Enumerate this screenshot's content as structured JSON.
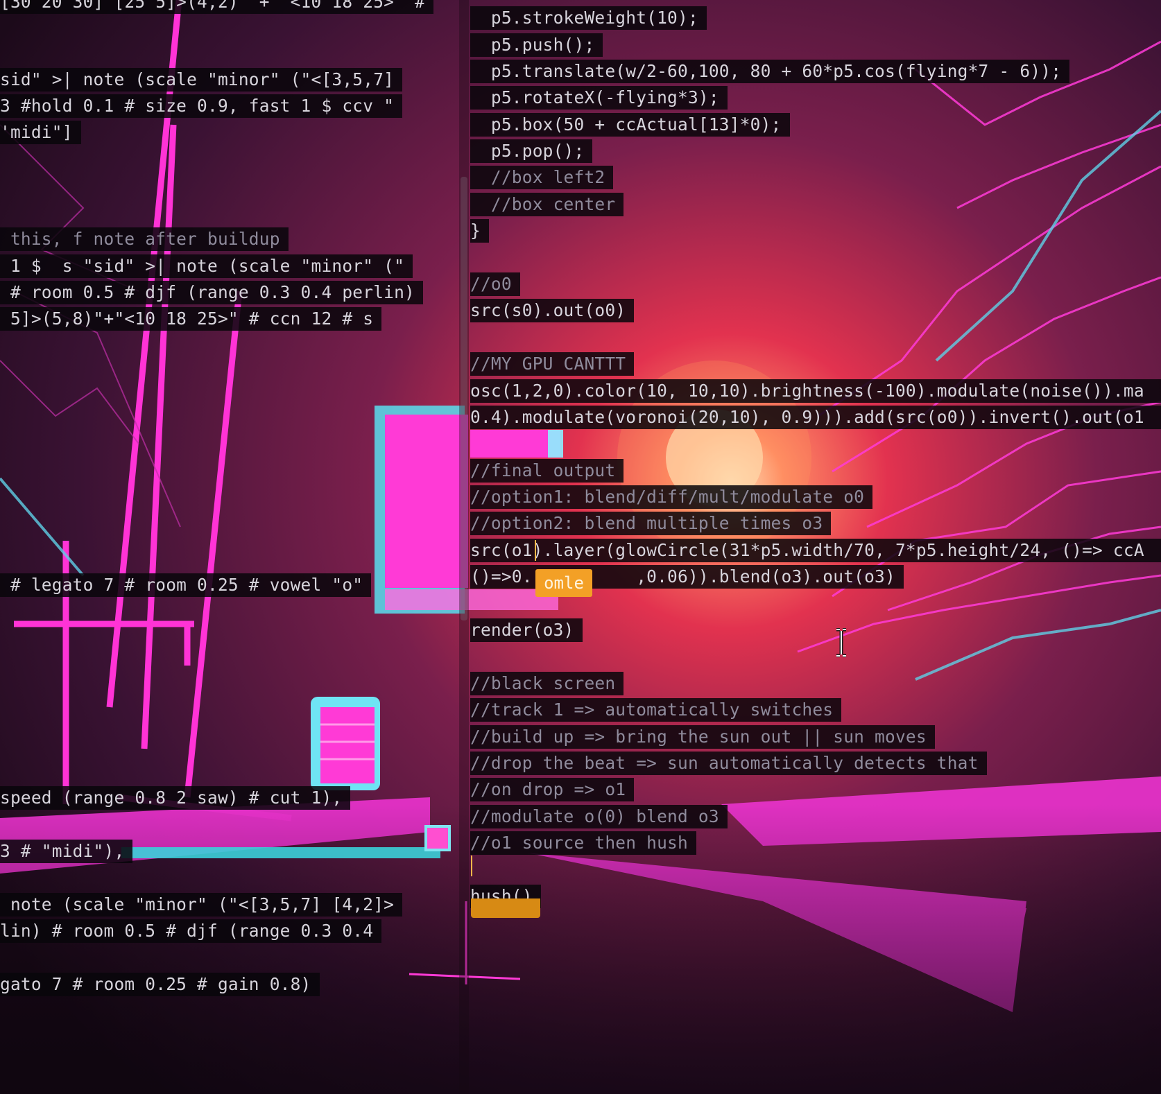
{
  "editor": {
    "left_pane": {
      "lines": [
        "[30 20 30] [25 5]>(4,2)\" + \"<10 18 25>\" #",
        "sid\" >| note (scale \"minor\" (\"<[3,5,7]",
        "3 #hold 0.1 # size 0.9, fast 1 $ ccv \"",
        "'midi\"]",
        " this, f note after buildup",
        " 1 $  s \"sid\" >| note (scale \"minor\" (\"",
        " # room 0.5 # djf (range 0.3 0.4 perlin)",
        " 5]>(5,8)\"+\"<10 18 25>\" # ccn 12 # s",
        " # legato 7 # room 0.25 # vowel \"o\"",
        "speed (range 0.8 2 saw) # cut 1),",
        "3 # \"midi\"),",
        " note (scale \"minor\" (\"<[3,5,7] [4,2]>",
        "lin) # room 0.5 # djf (range 0.3 0.4",
        "gato 7 # room 0.25 # gain 0.8)"
      ]
    },
    "right_pane": {
      "lines": [
        "  p5.strokeWeight(10);",
        "  p5.push();",
        "  p5.translate(w/2-60,100, 80 + 60*p5.cos(flying*7 - 6));",
        "  p5.rotateX(-flying*3);",
        "  p5.box(50 + ccActual[13]*0);",
        "  p5.pop();",
        "  //box left2",
        "  //box center",
        "}",
        "//o0",
        "src(s0).out(o0)",
        "//MY GPU CANTTT",
        "osc(1,2,0).color(10, 10,10).brightness(-100).modulate(noise()).ma",
        "0.4).modulate(voronoi(20,10), 0.9))).add(src(o0)).invert().out(o1",
        "//final output",
        "//option1: blend/diff/mult/modulate o0",
        "//option2: blend multiple times o3",
        "src(o1).layer(glowCircle(31*p5.width/70, 7*p5.height/24, ()=> ccA",
        "()=>0.          ,0.06)).blend(o3).out(o3)",
        "render(o3)",
        "//black screen",
        "//track 1 => automatically switches",
        "//build up => bring the sun out || sun moves",
        "//drop the beat => sun automatically detects that",
        "//on drop => o1",
        "//modulate o(0) blend o3",
        "//o1 source then hush",
        "hush()"
      ],
      "autocomplete_text": "omle"
    }
  },
  "icons": {
    "text_cursor": "i-beam-cursor-icon"
  },
  "colors": {
    "accent_pink": "#ff2fd0",
    "accent_cyan": "#54d8e8",
    "sun": "#ffd9a0",
    "code_bg": "#08060a",
    "highlight": "#f3a026"
  }
}
